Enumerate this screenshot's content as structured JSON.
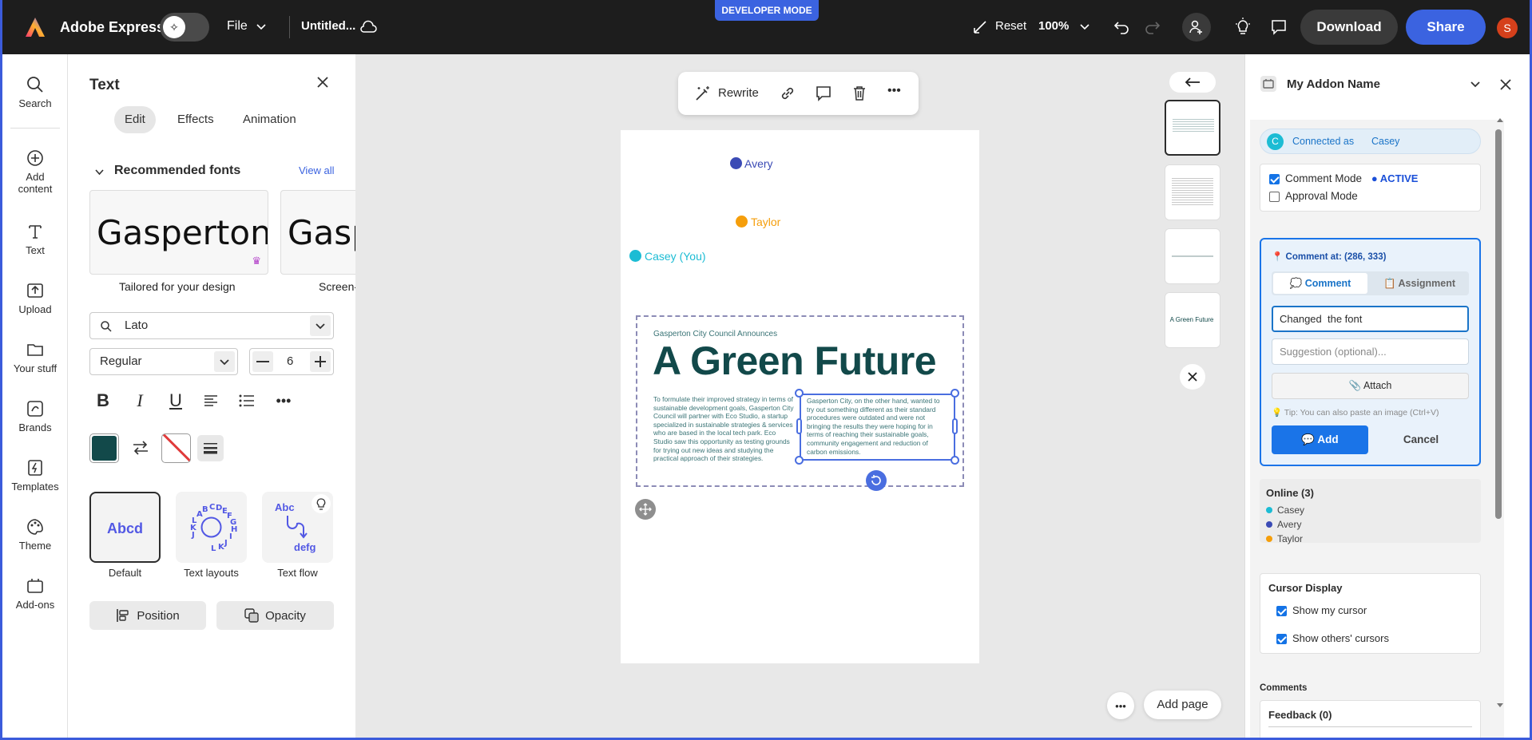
{
  "topbar": {
    "app_name": "Adobe Express",
    "file_label": "File",
    "doc_title": "Untitled...",
    "dev_mode": "DEVELOPER MODE",
    "reset_label": "Reset",
    "zoom": "100%",
    "download_label": "Download",
    "share_label": "Share",
    "avatar_initial": "S"
  },
  "rail": {
    "items": [
      {
        "label": "Search",
        "icon": "search-icon"
      },
      {
        "label": "Add content",
        "icon": "plus-circle-icon"
      },
      {
        "label": "Text",
        "icon": "text-icon"
      },
      {
        "label": "Upload",
        "icon": "upload-icon"
      },
      {
        "label": "Your stuff",
        "icon": "folder-icon"
      },
      {
        "label": "Brands",
        "icon": "brands-icon"
      },
      {
        "label": "Templates",
        "icon": "templates-icon"
      },
      {
        "label": "Theme",
        "icon": "palette-icon"
      },
      {
        "label": "Add-ons",
        "icon": "addons-icon"
      }
    ]
  },
  "text_panel": {
    "title": "Text",
    "tabs": [
      "Edit",
      "Effects",
      "Animation"
    ],
    "section_title": "Recommended fonts",
    "view_all": "View all",
    "font_cards": [
      {
        "sample": "Gasperton C",
        "caption": "Tailored for your design"
      },
      {
        "sample": "Gasp",
        "caption": "Screen-"
      }
    ],
    "font_family": "Lato",
    "font_weight": "Regular",
    "font_size": "6",
    "text_color": "#12494a",
    "tiles": [
      {
        "label": "Default",
        "sample": "Abcd"
      },
      {
        "label": "Text layouts",
        "sample": "ABCDEFGHIJKL"
      },
      {
        "label": "Text flow",
        "sample_top": "Abc",
        "sample_bottom": "defg"
      }
    ],
    "position_label": "Position",
    "opacity_label": "Opacity"
  },
  "canvas": {
    "toolbar": {
      "rewrite_label": "Rewrite"
    },
    "cursors": [
      {
        "name": "Avery",
        "color": "#3b4bb5"
      },
      {
        "name": "Taylor",
        "color": "#f59e0b"
      },
      {
        "name": "Casey (You)",
        "color": "#1cbcd4"
      }
    ],
    "doc": {
      "kicker": "Gasperton City Council Announces",
      "headline": "A Green Future",
      "col1": "To formulate their improved strategy in terms of sustainable development goals, Gasperton City Council will partner with Eco Studio, a startup specialized in sustainable strategies & services who are based in the local tech park. Eco Studio saw this opportunity as testing grounds for trying out new ideas and studying the practical approach of their strategies.",
      "col2": "Gasperton City, on the other hand, wanted to try out something different as their standard procedures were outdated and were not bringing the results they were hoping for in terms of reaching their sustainable goals, community engagement and reduction of carbon emissions."
    },
    "thumb_label": "A Green Future",
    "add_page": "Add page"
  },
  "addon": {
    "title": "My Addon Name",
    "connected_prefix": "Connected as",
    "connected_user": "Casey",
    "connected_initial": "C",
    "comment_mode": "Comment Mode",
    "active_badge": "● ACTIVE",
    "approval_mode": "Approval Mode",
    "comment_at": "📍 Comment at: (286, 333)",
    "tab_comment": "💭 Comment",
    "tab_assignment": "📋 Assignment",
    "comment_value": "Changed  the font",
    "suggestion_placeholder": "Suggestion (optional)...",
    "attach_label": "📎 Attach",
    "tip": "💡 Tip: You can also paste an image (Ctrl+V)",
    "add_label": "💬 Add",
    "cancel_label": "Cancel",
    "online_title": "Online (3)",
    "online_users": [
      {
        "name": "Casey",
        "color": "#1cbcd4"
      },
      {
        "name": "Avery",
        "color": "#3b4bb5"
      },
      {
        "name": "Taylor",
        "color": "#f59e0b"
      }
    ],
    "cursor_display_title": "Cursor Display",
    "show_my_cursor": "Show my cursor",
    "show_others": "Show others' cursors",
    "comments_title": "Comments",
    "feedback_title": "Feedback (0)"
  }
}
